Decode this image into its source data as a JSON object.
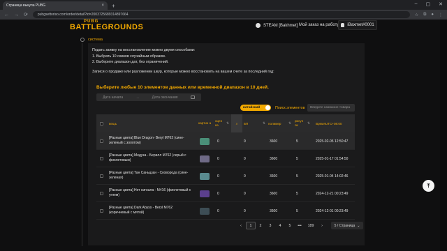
{
  "browser": {
    "tab_title": "Страница выкупа PUBG",
    "url": "pubgsettoriso.com/order/detail?id=2003725689314897664",
    "new_tab": "+",
    "close": "×"
  },
  "header": {
    "logo_top": "PUBG",
    "logo_main": "BATTLEGROUNDS",
    "steam_label": "STEAM [Bakhmet]",
    "order_label": "Мой заказ на работу",
    "user_label": "iBaxmet#0001"
  },
  "section": {
    "label": "система"
  },
  "intro": {
    "line1": "Подать заявку на восстановление можно двумя способами:",
    "line2": "1. Выбрать 10 скинов случайным образом.",
    "line3": "2. Выберите диапазон дат, без ограничений.",
    "hint": "Записи о продаже или разложении шкур, которые можно восстановить на вашем счете за последний год:"
  },
  "filters": {
    "title": "Выберите любые 10 элементов данных или временной диапазон в 10 дней.",
    "date_start": "Дата начала",
    "date_arrow": "→",
    "date_end": "Дата окончания",
    "toggle_label": "китайский",
    "search_mode": "Поиск элементов",
    "search_placeholder": "Введите название товара"
  },
  "table": {
    "columns": {
      "item": "вещь",
      "picture": "картин а",
      "rating": "оцен ка",
      "bp": "БП",
      "polymer": "полимер",
      "drawing": "рисун ок",
      "time": "ВремяUTC+08:00"
    },
    "rows": [
      {
        "item_line1": "[Разные цвета] Blue Dragon- Beryl M762 (сине-",
        "item_line2": "зеленый с золотом)",
        "rating": "0",
        "bp": "0",
        "polymer": "3600",
        "drawing": "5",
        "time": "2025-02-05 12:50:47",
        "pic_color": "#4a8f78"
      },
      {
        "item_line1": "[Разные цвета] Медуза - Берилл M762 (серый с",
        "item_line2": "фиолетовым)",
        "rating": "0",
        "bp": "0",
        "polymer": "3600",
        "drawing": "5",
        "time": "2025-01-17 01:54:50",
        "pic_color": "#6f6a86"
      },
      {
        "item_line1": "[Разные цвета] Тан Саньцзан - Сковорода (сине-",
        "item_line2": "зеленая)",
        "rating": "0",
        "bp": "0",
        "polymer": "3600",
        "drawing": "5",
        "time": "2025-01-04 14:02:46",
        "pic_color": "#5a8a8f"
      },
      {
        "item_line1": "[Разные цвета] Нет сигнала - M416 (фиолетовый с",
        "item_line2": "углем)",
        "rating": "0",
        "bp": "0",
        "polymer": "3600",
        "drawing": "5",
        "time": "2024-12-21 00:23:49",
        "pic_color": "#5b3f8c"
      },
      {
        "item_line1": "[Разные цвета] Dark Abyss - Beryl M762",
        "item_line2": "(коричневый с мятой)",
        "rating": "0",
        "bp": "0",
        "polymer": "3600",
        "drawing": "5",
        "time": "2024-12-01 00:23:49",
        "pic_color": "#3d4d55"
      }
    ]
  },
  "pagination": {
    "prev": "‹",
    "pages": [
      "1",
      "2",
      "3",
      "4",
      "5"
    ],
    "ellipsis": "•••",
    "last": "189",
    "next": "›",
    "per_page": "5 / Страница",
    "per_page_arrow": "⌄"
  },
  "scroll_top": "⤒"
}
